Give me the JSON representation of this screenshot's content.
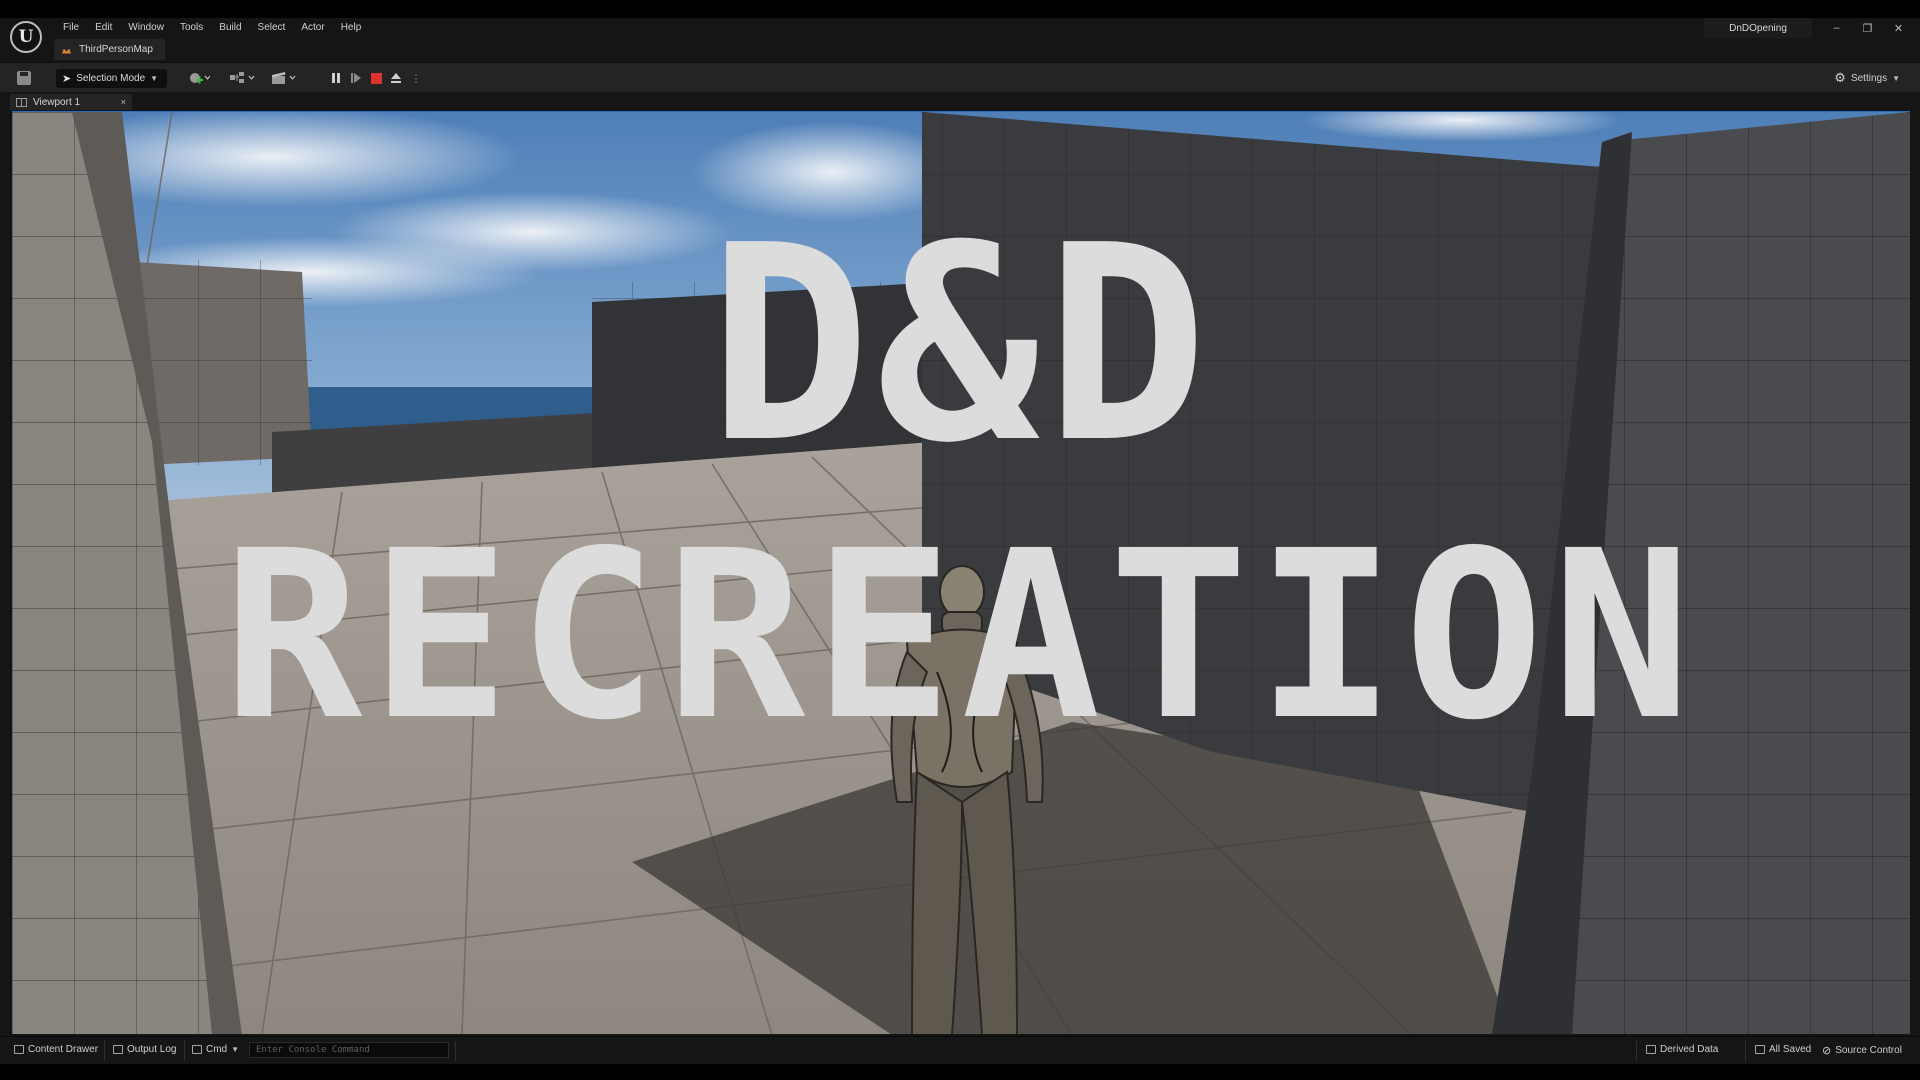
{
  "menubar": {
    "logo": "U",
    "items": [
      "File",
      "Edit",
      "Window",
      "Tools",
      "Build",
      "Select",
      "Actor",
      "Help"
    ],
    "doc_tab": "ThirdPersonMap",
    "project": "DnDOpening"
  },
  "window_controls": {
    "minimize": "–",
    "restore": "❐",
    "close": "✕"
  },
  "toolbar": {
    "selection_mode": "Selection Mode",
    "settings": "Settings",
    "pie_state": "playing"
  },
  "viewport_tab": {
    "label": "Viewport 1",
    "close": "×"
  },
  "overlay": {
    "line1": "D&D",
    "line2": "RECREATION"
  },
  "statusbar": {
    "content_drawer": "Content Drawer",
    "output_log": "Output Log",
    "cmd": "Cmd",
    "console_placeholder": "Enter Console Command",
    "derived_data": "Derived Data",
    "all_saved": "All Saved",
    "source_control": "Source Control"
  },
  "colors": {
    "chrome_dark": "#151515",
    "panel": "#242424",
    "stop_red": "#e03131",
    "map_icon": "#d9822b",
    "viewport_accent": "#2d6fbf",
    "overlay_text": "#dcdcdc"
  }
}
